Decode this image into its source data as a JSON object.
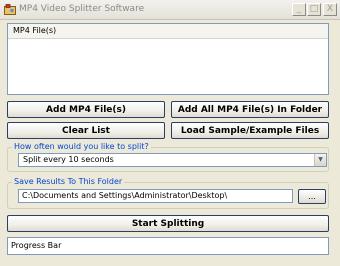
{
  "window": {
    "title": "MP4 Video Splitter Software",
    "min_glyph": "_",
    "max_glyph": "□",
    "close_glyph": "X"
  },
  "file_list": {
    "header": "MP4 File(s)"
  },
  "buttons": {
    "add_files": "Add MP4 File(s)",
    "add_all_files": "Add All MP4 File(s) In Folder",
    "clear_list": "Clear List",
    "load_sample": "Load Sample/Example Files",
    "start": "Start Splitting",
    "browse": "..."
  },
  "split": {
    "label": "How often would you like to split?",
    "selected": "Split every 10 seconds",
    "arrow_glyph": "▼"
  },
  "save": {
    "label": "Save Results To This Folder",
    "path": "C:\\Documents and Settings\\Administrator\\Desktop\\"
  },
  "progress": {
    "text": "Progress Bar"
  },
  "icons": {
    "app": "app-icon",
    "dropdown": "chevron-down-icon"
  }
}
